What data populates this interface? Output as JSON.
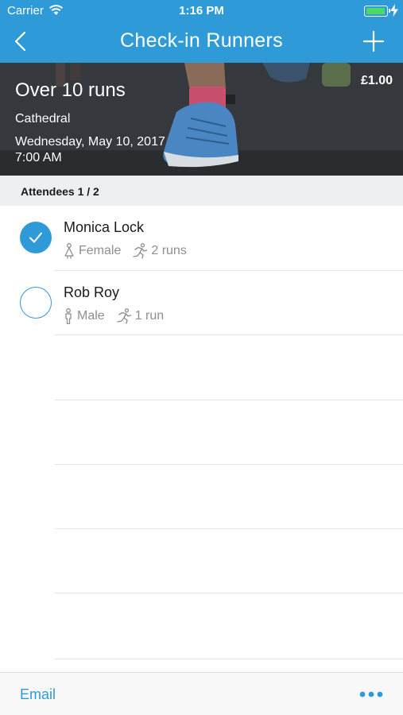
{
  "status_bar": {
    "carrier": "Carrier",
    "time": "1:16 PM",
    "battery_level": 1.0
  },
  "nav": {
    "title": "Check-in Runners",
    "back_icon": "chevron-left-icon",
    "add_icon": "plus-icon"
  },
  "event": {
    "title": "Over 10 runs",
    "price": "£1.00",
    "venue": "Cathedral",
    "date": "Wednesday, May 10, 2017",
    "time": "7:00 AM"
  },
  "attendees": {
    "header": "Attendees 1 / 2",
    "items": [
      {
        "name": "Monica Lock",
        "gender": "Female",
        "runs": "2 runs",
        "checked": true
      },
      {
        "name": "Rob Roy",
        "gender": "Male",
        "runs": "1 run",
        "checked": false
      }
    ]
  },
  "footer": {
    "email_label": "Email",
    "more_icon": "more-dots-icon"
  },
  "colors": {
    "accent": "#2e9bd8",
    "section_bg": "#eeeff1",
    "secondary_text": "#8e8e93",
    "battery": "#4cd964"
  }
}
